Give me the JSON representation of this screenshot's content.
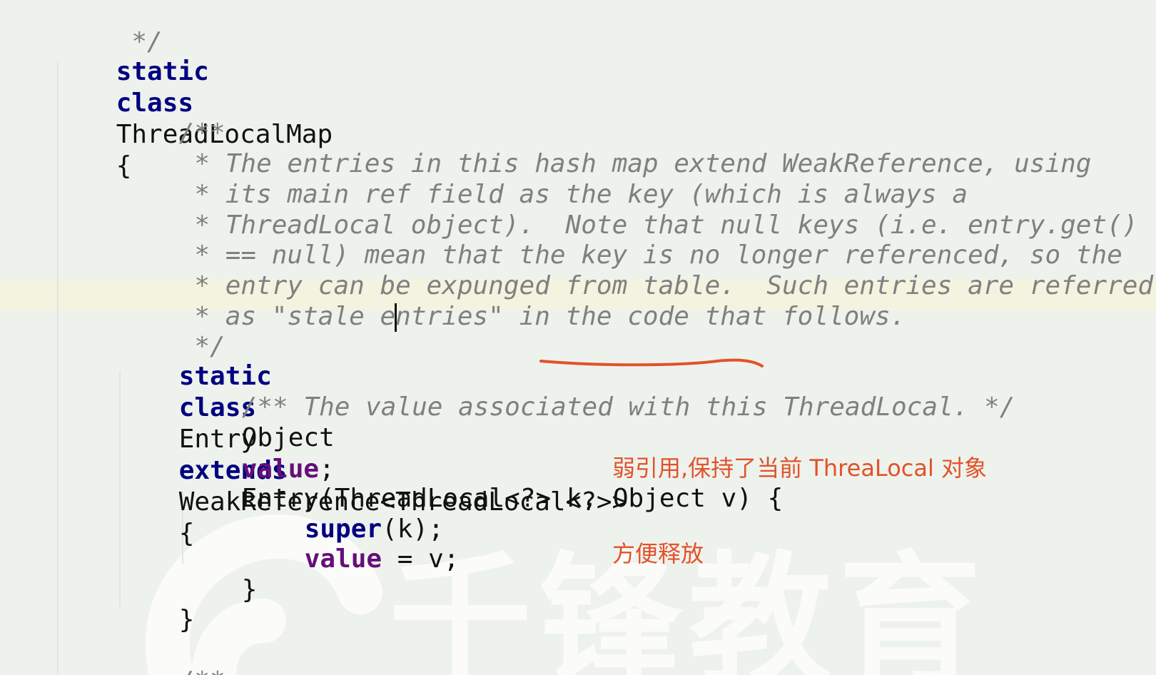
{
  "watermark": {
    "text": "千锋教育",
    "color": "#ffffff"
  },
  "annotation": {
    "line1": "弱引用,保持了当前 ThreaLocal 对象",
    "line2": "方便释放",
    "color": "#e2522a"
  },
  "colors": {
    "background": "#eef2ec",
    "keyword": "#000080",
    "field": "#660e7a",
    "comment": "#808080",
    "text": "#111111",
    "current_line": "#f4f3df"
  },
  "code": {
    "l01": {
      "comment": " */"
    },
    "l02": {
      "kw1": "static",
      "kw2": "class",
      "name": "ThreadLocalMap",
      "brace": "{"
    },
    "l04": {
      "comment": "/**"
    },
    "l05": {
      "comment": " * The entries in this hash map extend WeakReference, using"
    },
    "l06": {
      "comment": " * its main ref field as the key (which is always a"
    },
    "l07": {
      "comment": " * ThreadLocal object).  Note that null keys (i.e. entry.get()"
    },
    "l08": {
      "comment": " * == null) mean that the key is no longer referenced, so the"
    },
    "l09": {
      "comment": " * entry can be expunged from table.  Such entries are referred to"
    },
    "l10": {
      "comment_a": " * as \"stale e",
      "comment_b": "ntries\" in the code that follows."
    },
    "l11": {
      "comment": " */"
    },
    "l12": {
      "kw1": "static",
      "kw2": "class",
      "name": "Entry",
      "kw3": "extends",
      "super_type": "WeakReference",
      "type_args": "<ThreadLocal<?>>",
      "brace": "{"
    },
    "l13": {
      "comment": "/** The value associated with this ThreadLocal. */"
    },
    "l14": {
      "type": "Object",
      "field": "value",
      "semi": ";"
    },
    "l16": {
      "text": "Entry(ThreadLocal<?> k, Object v) {"
    },
    "l17": {
      "kw": "super",
      "rest": "(k);"
    },
    "l18": {
      "field": "value",
      "rest": " = v;"
    },
    "l19": {
      "text": "}"
    },
    "l20": {
      "text": "}"
    },
    "l22": {
      "comment": "/**"
    }
  }
}
